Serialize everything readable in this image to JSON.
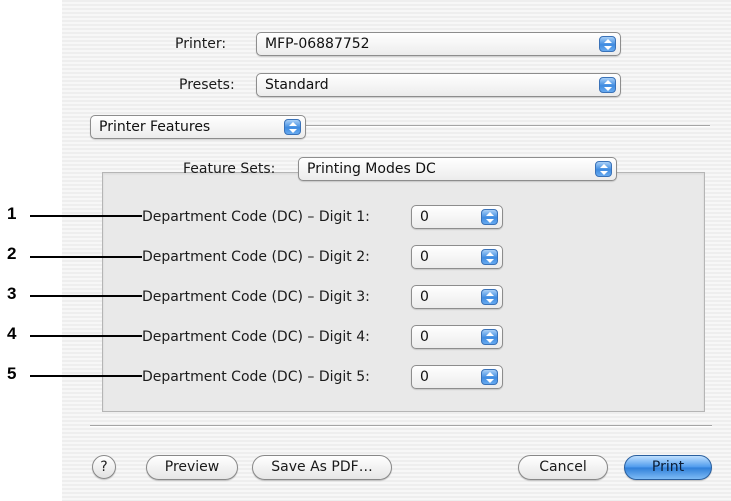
{
  "printer": {
    "label": "Printer:",
    "value": "MFP-06887752"
  },
  "presets": {
    "label": "Presets:",
    "value": "Standard"
  },
  "pane_menu": {
    "value": "Printer Features"
  },
  "feature_sets": {
    "label": "Feature Sets:",
    "value": "Printing Modes DC"
  },
  "dc_rows": [
    {
      "callout": "1",
      "label": "Department Code (DC) – Digit 1:",
      "value": "0"
    },
    {
      "callout": "2",
      "label": "Department Code (DC) – Digit 2:",
      "value": "0"
    },
    {
      "callout": "3",
      "label": "Department Code (DC) – Digit 3:",
      "value": "0"
    },
    {
      "callout": "4",
      "label": "Department Code (DC) – Digit 4:",
      "value": "0"
    },
    {
      "callout": "5",
      "label": "Department Code (DC) – Digit 5:",
      "value": "0"
    }
  ],
  "buttons": {
    "help": "?",
    "preview": "Preview",
    "save_pdf": "Save As PDF…",
    "cancel": "Cancel",
    "print": "Print"
  },
  "colors": {
    "accent": "#3f8be0",
    "background_stripe": "#eeeeee"
  }
}
